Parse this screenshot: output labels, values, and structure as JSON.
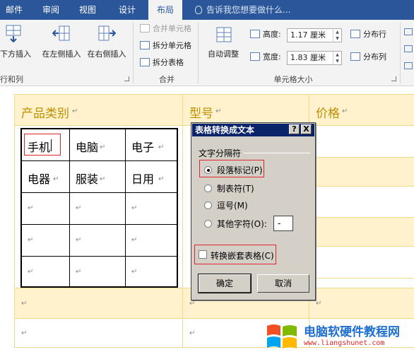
{
  "tabs": [
    {
      "label": "邮件",
      "active": false
    },
    {
      "label": "审阅",
      "active": false
    },
    {
      "label": "视图",
      "active": false
    },
    {
      "label": "设计",
      "active": false
    },
    {
      "label": "布局",
      "active": true
    }
  ],
  "tell_me": "告诉我您想要做什么...",
  "ribbon": {
    "insert_below": "下方插入",
    "insert_left": "在左侧插入",
    "insert_right": "在右侧插入",
    "group_rows": "行和列",
    "merge_cells": "合并单元格",
    "split_cells": "拆分单元格",
    "split_table": "拆分表格",
    "group_merge": "合并",
    "autofit": "自动调整",
    "height_label": "高度:",
    "height_value": "1.17 厘米",
    "width_label": "宽度:",
    "width_value": "1.83 厘米",
    "distribute_rows": "分布行",
    "distribute_cols": "分布列",
    "group_cellsize": "单元格大小"
  },
  "outer_table": {
    "headers": [
      "产品类别",
      "型号",
      "价格"
    ],
    "colors": {
      "header_bg": "#fff2cc",
      "header_text": "#bf8f00",
      "border": "#f1d88a"
    }
  },
  "inner_table": {
    "rows": [
      [
        "手机",
        "电脑",
        "电子"
      ],
      [
        "电器",
        "服装",
        "日用"
      ],
      [
        "",
        "",
        ""
      ],
      [
        "",
        "",
        ""
      ],
      [
        "",
        "",
        ""
      ]
    ]
  },
  "dialog": {
    "title": "表格转换成文本",
    "help": "?",
    "close": "X",
    "group_label": "文字分隔符",
    "options": [
      {
        "label": "段落标记(P)",
        "checked": true
      },
      {
        "label": "制表符(T)",
        "checked": false
      },
      {
        "label": "逗号(M)",
        "checked": false
      },
      {
        "label": "其他字符(O):",
        "checked": false
      }
    ],
    "other_value": "-",
    "nested_label": "转换嵌套表格(C)",
    "nested_checked": false,
    "ok": "确定",
    "cancel": "取消"
  },
  "watermark": {
    "title": "电脑软硬件教程网",
    "url": "www.liangshunet.com"
  },
  "accent": "#2b579a"
}
